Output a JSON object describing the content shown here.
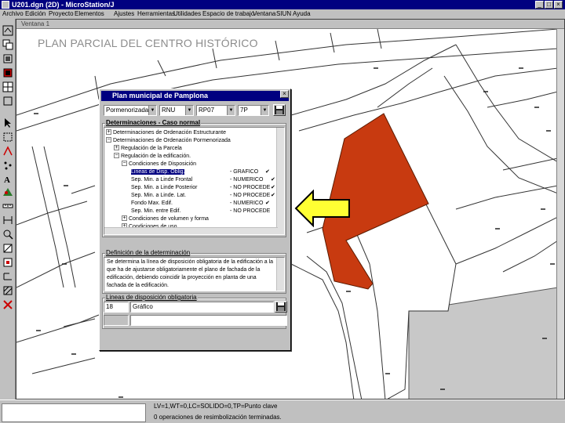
{
  "window": {
    "title": "U201.dgn (2D) - MicroStation/J"
  },
  "menu": [
    "Archivo",
    "Edición",
    "Proyecto",
    "Elementos",
    "Ajustes",
    "Herramientas",
    "Utilidades",
    "Espacio de trabajo",
    "Ventana",
    "SIUN",
    "Ayuda"
  ],
  "view": {
    "title": "Ventana 1"
  },
  "slide_title": "PLAN PARCIAL DEL CENTRO HISTÓRICO",
  "dialog": {
    "title": "Plan municipal de Pamplona",
    "combos": [
      "Pormenorizada",
      "RNU",
      "RP07",
      "7P"
    ],
    "section_determinaciones": "Determinaciones - Caso normal",
    "tree": [
      {
        "label": "Determinaciones de Ordenación Estructurante",
        "value": "",
        "check": ""
      },
      {
        "label": "Determinaciones de Ordenación Pormenorizada",
        "value": "",
        "check": ""
      },
      {
        "label": "Regulación de la Parcela",
        "value": "",
        "check": ""
      },
      {
        "label": "Regulación de la edificación.",
        "value": "",
        "check": ""
      },
      {
        "label": "Condiciones de Disposición",
        "value": "",
        "check": ""
      },
      {
        "label": "Lineas de Disp. Oblig.",
        "value": "- GRAFICO",
        "check": "✔"
      },
      {
        "label": "Sep. Min. a Linde Frontal",
        "value": "- NUMERICO",
        "check": "✔"
      },
      {
        "label": "Sep. Min. a Linde Posterior",
        "value": "- NO PROCEDE",
        "check": "✔"
      },
      {
        "label": "Sep. Min. a Linde. Lat.",
        "value": "- NO PROCEDE",
        "check": "✔"
      },
      {
        "label": "Fondo Max. Edif.",
        "value": "- NUMERICO",
        "check": "✔"
      },
      {
        "label": "Sep. Min. entre Edif.",
        "value": "- NO PROCEDE",
        "check": ""
      },
      {
        "label": "Condiciones de volumen y forma",
        "value": "",
        "check": ""
      },
      {
        "label": "Condiciones de uso",
        "value": "",
        "check": ""
      }
    ],
    "section_definicion": "Definición de la determinación",
    "definition": "Se determina la línea de disposición obligatoria de la edificación a la que ha de ajustarse obligatoriamente el plano de fachada de la edificación, debiendo coincidir la proyección en planta de una fachada de la edificación.",
    "section_lineas": "Lineas de disposición obligatoria",
    "lineas_num": "18",
    "lineas_value": "Gráfico"
  },
  "status": {
    "line1": "LV=1,WT=0,LC=SOLIDO=0,TP=Punto clave",
    "line2": "0 operaciones de resimbolización terminadas."
  },
  "colors": {
    "highlight_parcel": "#c83a10",
    "arrow_fill": "#ffff33",
    "titlebar": "#000080"
  }
}
